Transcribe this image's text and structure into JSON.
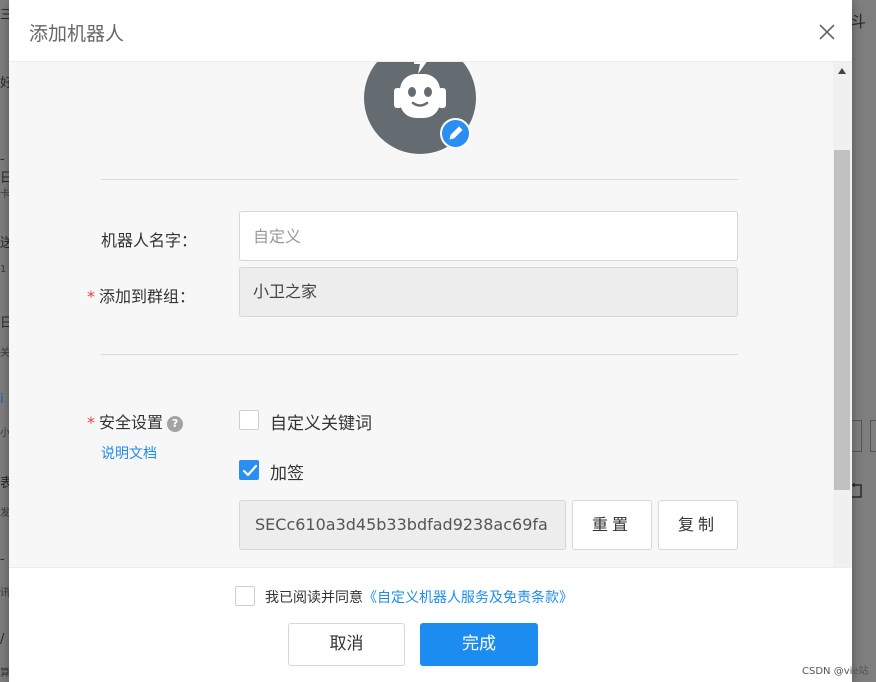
{
  "background": {
    "left_glyphs": [
      "三",
      "好",
      "-日",
      "卡",
      "送",
      "1",
      "日",
      "关",
      "i",
      "小",
      "表",
      "发",
      "-",
      "讯",
      "/",
      "算"
    ],
    "right_glyphs": [
      "斗"
    ]
  },
  "dialog": {
    "title": "添加机器人",
    "form": {
      "name": {
        "label": "机器人名字：",
        "placeholder": "自定义",
        "value": ""
      },
      "group": {
        "required_mark": "*",
        "label": "添加到群组：",
        "value": "小卫之家"
      },
      "security": {
        "required_mark": "*",
        "label": "安全设置",
        "help_glyph": "?",
        "doc_link": "说明文档",
        "options": [
          {
            "label": "自定义关键词",
            "checked": false
          },
          {
            "label": "加签",
            "checked": true
          }
        ],
        "secret_value": "SECc610a3d45b33bdfad9238ac69fa",
        "reset_label": "重置",
        "copy_label": "复制"
      }
    },
    "footer": {
      "agree_prefix": "我已阅读并同意",
      "agree_link": "《自定义机器人服务及免责条款》",
      "cancel_label": "取消",
      "done_label": "完成"
    }
  },
  "watermark": "CSDN @vie站",
  "colors": {
    "accent": "#1d8cf0",
    "required": "#e8414a",
    "avatar": "#646c72",
    "link": "#1f8ceb"
  }
}
